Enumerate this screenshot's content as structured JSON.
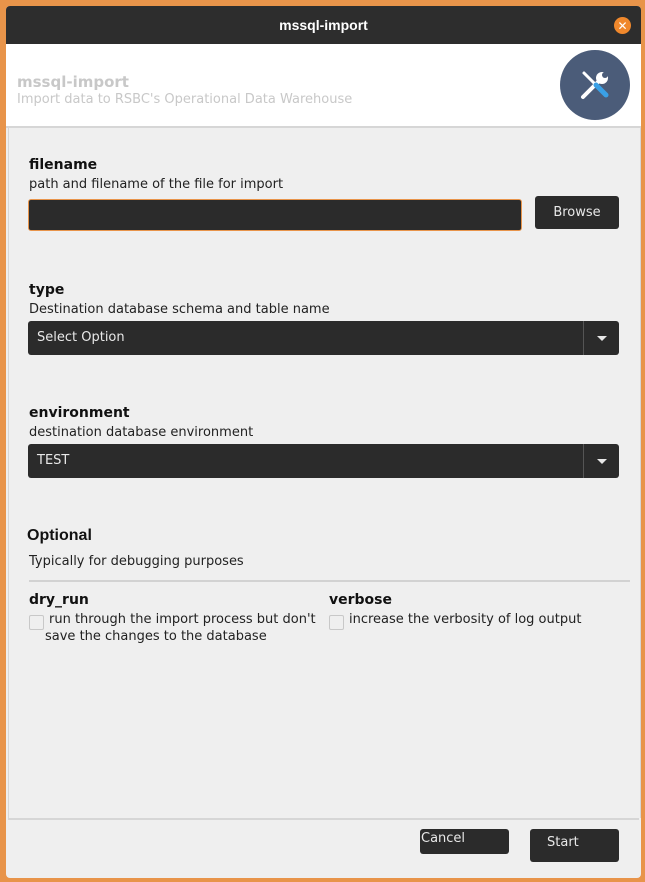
{
  "window": {
    "title": "mssql-import",
    "close_icon": "close-icon"
  },
  "header": {
    "app_name": "mssql-import",
    "app_description": "Import data to RSBC's Operational Data Warehouse",
    "logo_icon": "tools-icon",
    "logo_color": "#4b5c79"
  },
  "fields": {
    "filename": {
      "label": "filename",
      "help": "path and filename of the file for import",
      "value": "",
      "browse_label": "Browse"
    },
    "type": {
      "label": "type",
      "help": "Destination database schema and table name",
      "selected": "Select Option"
    },
    "environment": {
      "label": "environment",
      "help": "destination database environment",
      "selected": "TEST"
    }
  },
  "optional": {
    "title": "Optional",
    "description": "Typically for debugging purposes",
    "dry_run": {
      "label": "dry_run",
      "text_line1": "run through the import process but don't",
      "text_line2": "save the changes to the database",
      "checked": false
    },
    "verbose": {
      "label": "verbose",
      "text": "increase the verbosity of log output",
      "checked": false
    }
  },
  "footer": {
    "cancel_label": "Cancel",
    "start_label": "Start"
  },
  "colors": {
    "accent": "#e8944a",
    "dark_control": "#2b2b2b",
    "close": "#f0882c"
  }
}
